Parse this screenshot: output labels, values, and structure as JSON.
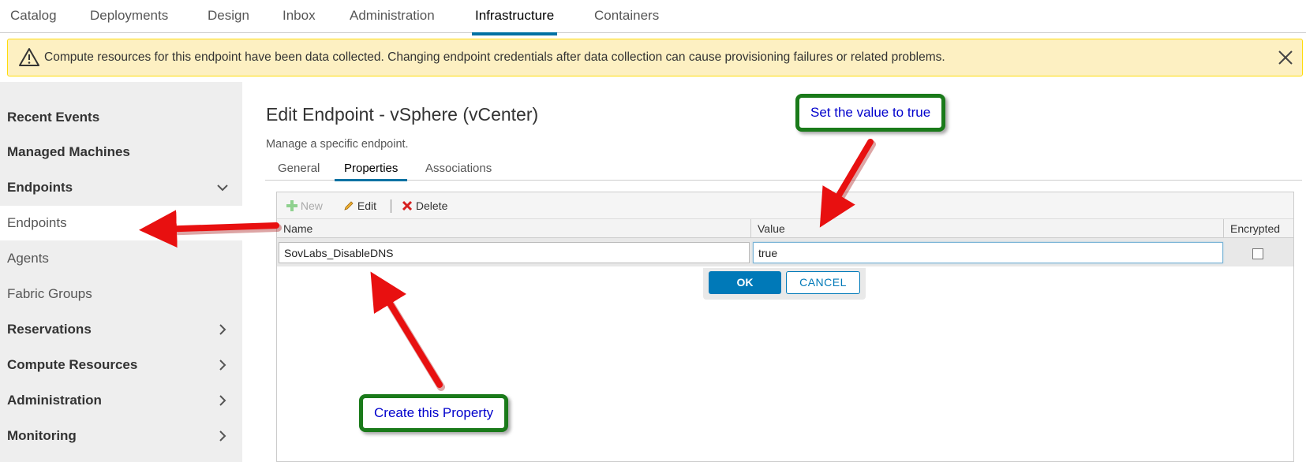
{
  "top_nav": {
    "tabs": [
      {
        "label": "Catalog"
      },
      {
        "label": "Deployments"
      },
      {
        "label": "Design"
      },
      {
        "label": "Inbox"
      },
      {
        "label": "Administration"
      },
      {
        "label": "Infrastructure"
      },
      {
        "label": "Containers"
      }
    ],
    "active": "Infrastructure"
  },
  "alert": {
    "message": "Compute resources for this endpoint have been data collected. Changing endpoint credentials after data collection can cause provisioning failures or related problems.",
    "icon": "warning-icon",
    "close_icon": "close-icon"
  },
  "sidebar": {
    "items": [
      {
        "label": "Recent Events"
      },
      {
        "label": "Managed Machines"
      },
      {
        "label": "Endpoints"
      },
      {
        "label": "Endpoints"
      },
      {
        "label": "Agents"
      },
      {
        "label": "Fabric Groups"
      },
      {
        "label": "Reservations"
      },
      {
        "label": "Compute Resources"
      },
      {
        "label": "Administration"
      },
      {
        "label": "Monitoring"
      }
    ]
  },
  "page": {
    "title": "Edit Endpoint - vSphere (vCenter)",
    "subtitle": "Manage a specific endpoint.",
    "tabs": [
      {
        "label": "General"
      },
      {
        "label": "Properties"
      },
      {
        "label": "Associations"
      }
    ],
    "active_tab": "Properties"
  },
  "grid": {
    "toolbar": {
      "new_label": "New",
      "edit_label": "Edit",
      "delete_label": "Delete"
    },
    "columns": [
      {
        "label": "Name"
      },
      {
        "label": "Value"
      },
      {
        "label": "Encrypted"
      }
    ],
    "edit_row": {
      "name": "SovLabs_DisableDNS",
      "value": "true",
      "encrypted": false
    },
    "ok_label": "OK",
    "cancel_label": "CANCEL"
  },
  "annotations": {
    "value_callout": "Set the value to true",
    "property_callout": "Create this Property"
  },
  "colors": {
    "accent": "#0072a3",
    "alert_bg": "#fdf0c2",
    "callout_border": "#1a7a1a",
    "callout_text": "#0000cc",
    "arrow": "#e81010"
  }
}
